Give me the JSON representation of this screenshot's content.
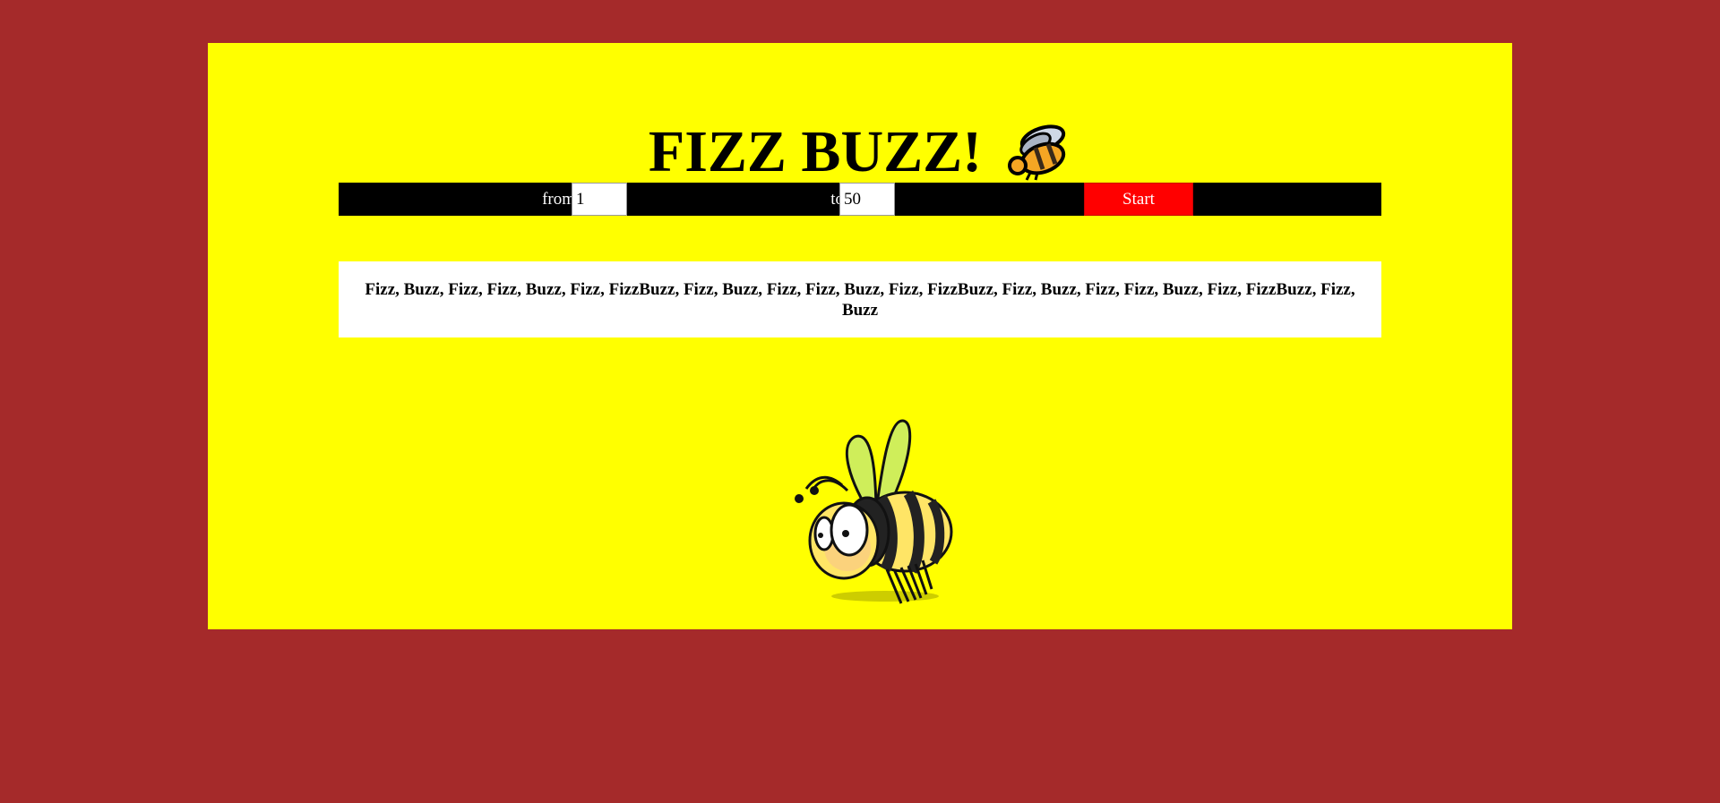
{
  "page": {
    "background_color": "#a52a2a",
    "panel_color": "#ffff00"
  },
  "header": {
    "title": "FIZZ BUZZ!",
    "icon": "bee-emoji-icon"
  },
  "controls": {
    "from_label": "from",
    "from_value": "1",
    "to_label": "to",
    "to_value": "50",
    "start_label": "Start",
    "start_color": "#ff0000"
  },
  "output": {
    "text": "Fizz, Buzz, Fizz, Fizz, Buzz, Fizz, FizzBuzz, Fizz, Buzz, Fizz, Fizz, Buzz, Fizz, FizzBuzz, Fizz, Buzz, Fizz, Fizz, Buzz, Fizz, FizzBuzz, Fizz, Buzz"
  },
  "illustration": {
    "icon": "bee-illustration-icon"
  }
}
